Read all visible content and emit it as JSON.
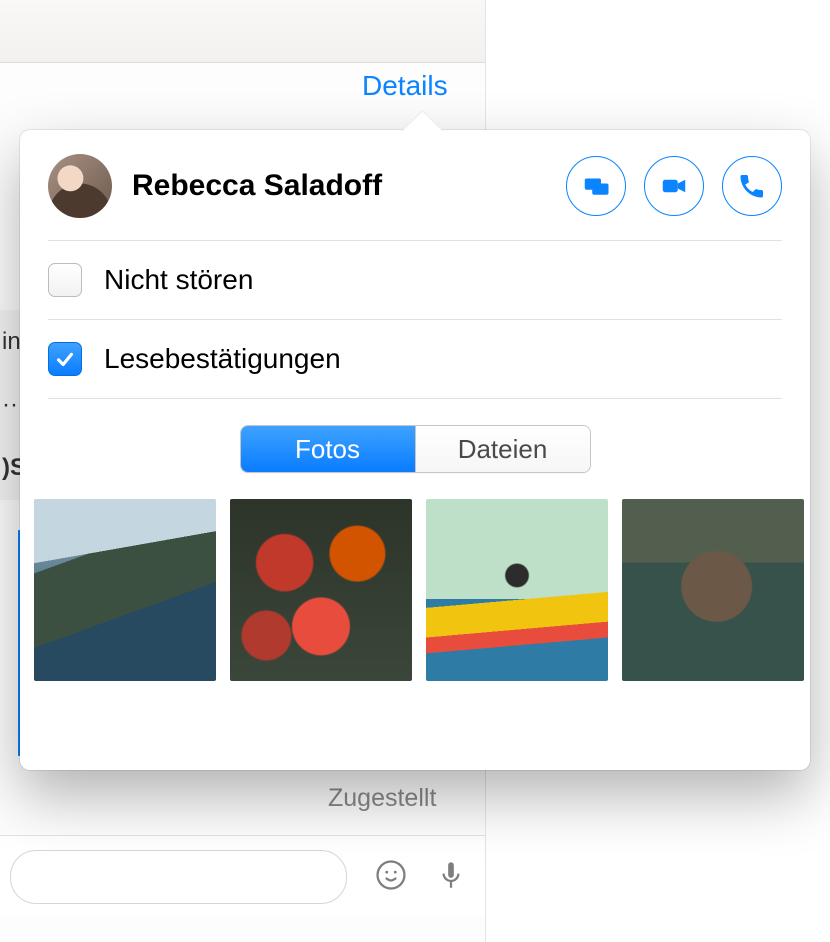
{
  "details_button_label": "Details",
  "contact": {
    "name": "Rebecca Saladoff"
  },
  "actions": {
    "share_screen": "screen-share",
    "video_call": "video-call",
    "audio_call": "audio-call"
  },
  "options": {
    "do_not_disturb": {
      "label": "Nicht stören",
      "checked": false
    },
    "read_receipts": {
      "label": "Lesebestätigungen",
      "checked": true
    }
  },
  "segmented": {
    "photos": "Fotos",
    "files": "Dateien",
    "active": "photos"
  },
  "thumbs": [
    {
      "name": "coastal-cliffs"
    },
    {
      "name": "starfish"
    },
    {
      "name": "kayaker"
    },
    {
      "name": "sea-otter"
    }
  ],
  "delivery_status": "Zugestellt"
}
